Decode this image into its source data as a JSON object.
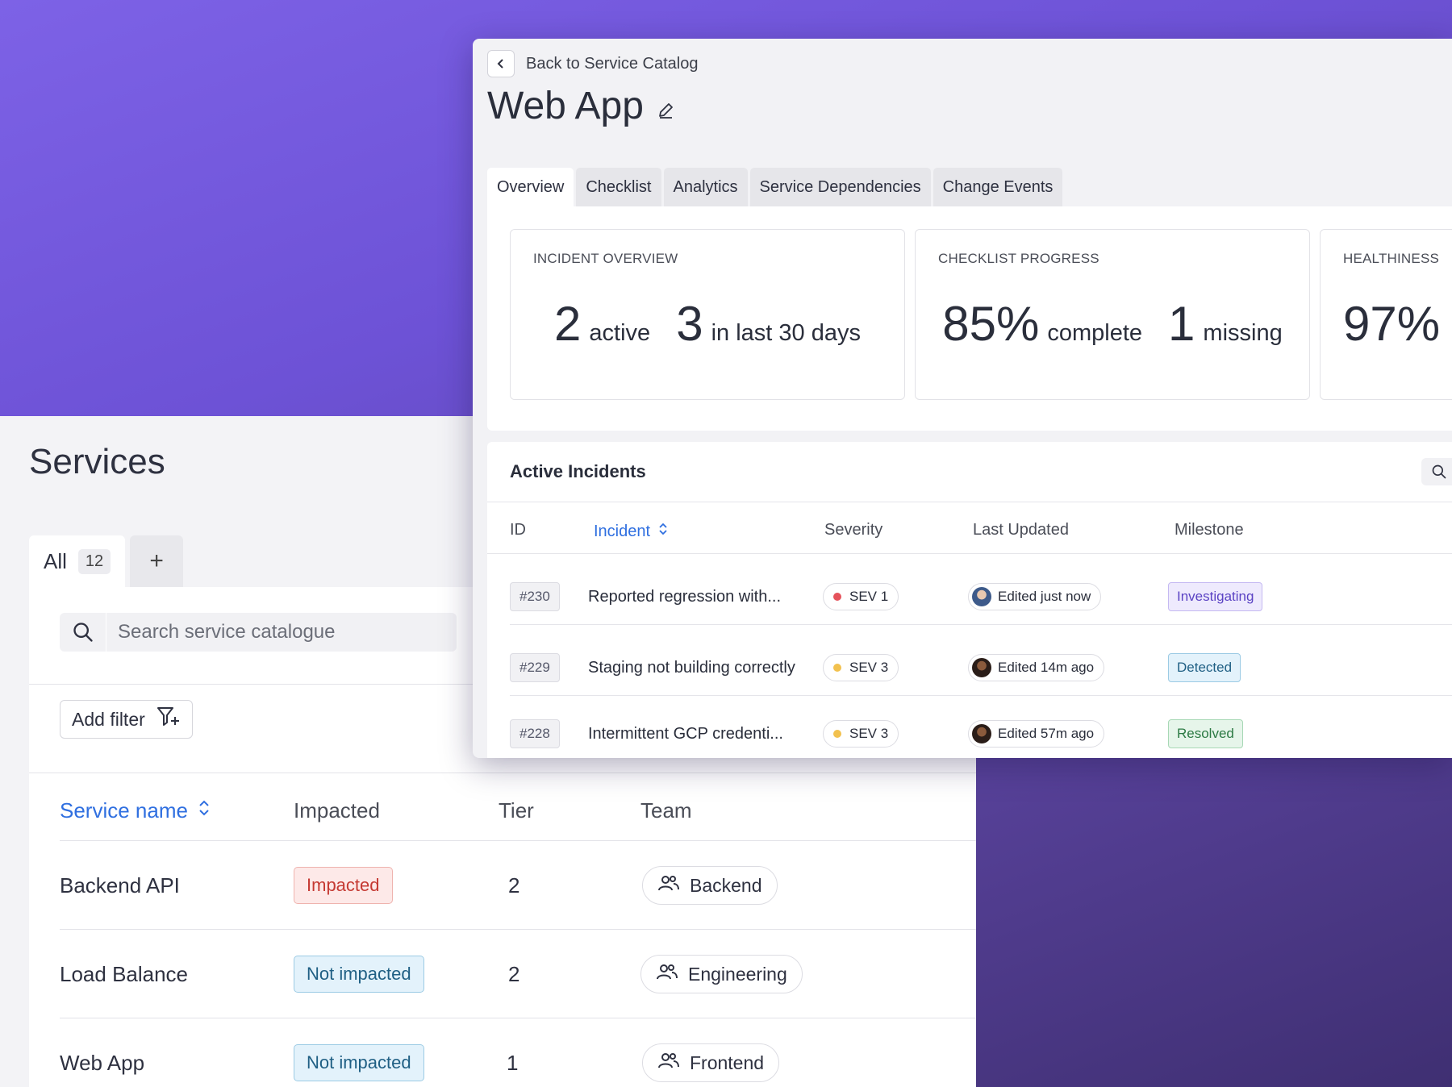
{
  "services": {
    "title": "Services",
    "tabs": [
      {
        "label": "All",
        "count": "12"
      },
      {
        "label": "+"
      }
    ],
    "search": {
      "placeholder": "Search service catalogue"
    },
    "filter_label": "Add filter",
    "columns": {
      "service_name": "Service name",
      "impacted": "Impacted",
      "tier": "Tier",
      "team": "Team"
    },
    "rows": [
      {
        "name": "Backend API",
        "impacted": "Impacted",
        "tier": "2",
        "team": "Backend"
      },
      {
        "name": "Load Balance",
        "impacted": "Not impacted",
        "tier": "2",
        "team": "Engineering"
      },
      {
        "name": "Web App",
        "impacted": "Not impacted",
        "tier": "1",
        "team": "Frontend"
      }
    ]
  },
  "webapp": {
    "back_label": "Back to Service Catalog",
    "title": "Web App",
    "tabs": [
      "Overview",
      "Checklist",
      "Analytics",
      "Service Dependencies",
      "Change Events"
    ],
    "stats": [
      {
        "label": "INCIDENT OVERVIEW",
        "v1": "2",
        "u1": "active",
        "v2": "3",
        "u2": "in last 30 days"
      },
      {
        "label": "CHECKLIST PROGRESS",
        "v1": "85%",
        "u1": "complete",
        "v2": "1",
        "u2": "missing"
      },
      {
        "label": "HEALTHINESS",
        "v1": "97%"
      }
    ],
    "incidents": {
      "title": "Active Incidents",
      "columns": {
        "id": "ID",
        "incident": "Incident",
        "severity": "Severity",
        "last_updated": "Last Updated",
        "milestone": "Milestone"
      },
      "rows": [
        {
          "id": "#230",
          "incident": "Reported regression with...",
          "severity": "SEV 1",
          "sev_color": "#e5525b",
          "updated": "Edited just now",
          "milestone": "Investigating"
        },
        {
          "id": "#229",
          "incident": "Staging not building correctly",
          "severity": "SEV 3",
          "sev_color": "#f2c14e",
          "updated": "Edited 14m ago",
          "milestone": "Detected"
        },
        {
          "id": "#228",
          "incident": "Intermittent GCP credenti...",
          "severity": "SEV 3",
          "sev_color": "#f2c14e",
          "updated": "Edited 57m ago",
          "milestone": "Resolved"
        }
      ]
    }
  },
  "colors": {
    "accent": "#2f6fe0",
    "background": "#7d62e6"
  }
}
